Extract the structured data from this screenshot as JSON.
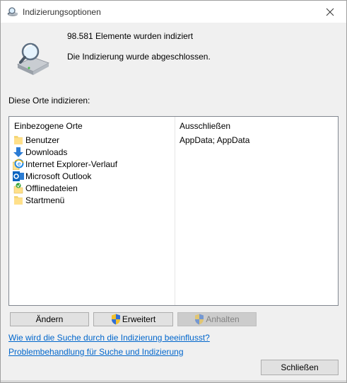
{
  "window": {
    "title": "Indizierungsoptionen",
    "title_icon": "search-index-icon",
    "close_icon": "close-icon"
  },
  "status": {
    "icon": "indexing-drive-magnifier-icon",
    "count_text": "98.581 Elemente wurden indiziert",
    "message": "Die Indizierung wurde abgeschlossen."
  },
  "section_label": "Diese Orte indizieren:",
  "table": {
    "header_included": "Einbezogene Orte",
    "header_excluded": "Ausschließen",
    "locations": [
      {
        "label": "Benutzer",
        "icon": "folder-icon"
      },
      {
        "label": "Downloads",
        "icon": "download-arrow-icon"
      },
      {
        "label": "Internet Explorer-Verlauf",
        "icon": "internet-explorer-icon"
      },
      {
        "label": "Microsoft Outlook",
        "icon": "outlook-icon"
      },
      {
        "label": "Offlinedateien",
        "icon": "offline-files-icon"
      },
      {
        "label": "Startmenü",
        "icon": "folder-icon"
      }
    ],
    "exclusions": "AppData; AppData"
  },
  "buttons": {
    "modify": "Ändern",
    "advanced": "Erweitert",
    "pause": "Anhalten",
    "close": "Schließen"
  },
  "links": {
    "help": "Wie wird die Suche durch die Indizierung beeinflusst?",
    "troubleshoot": "Problembehandlung für Suche und Indizierung"
  }
}
